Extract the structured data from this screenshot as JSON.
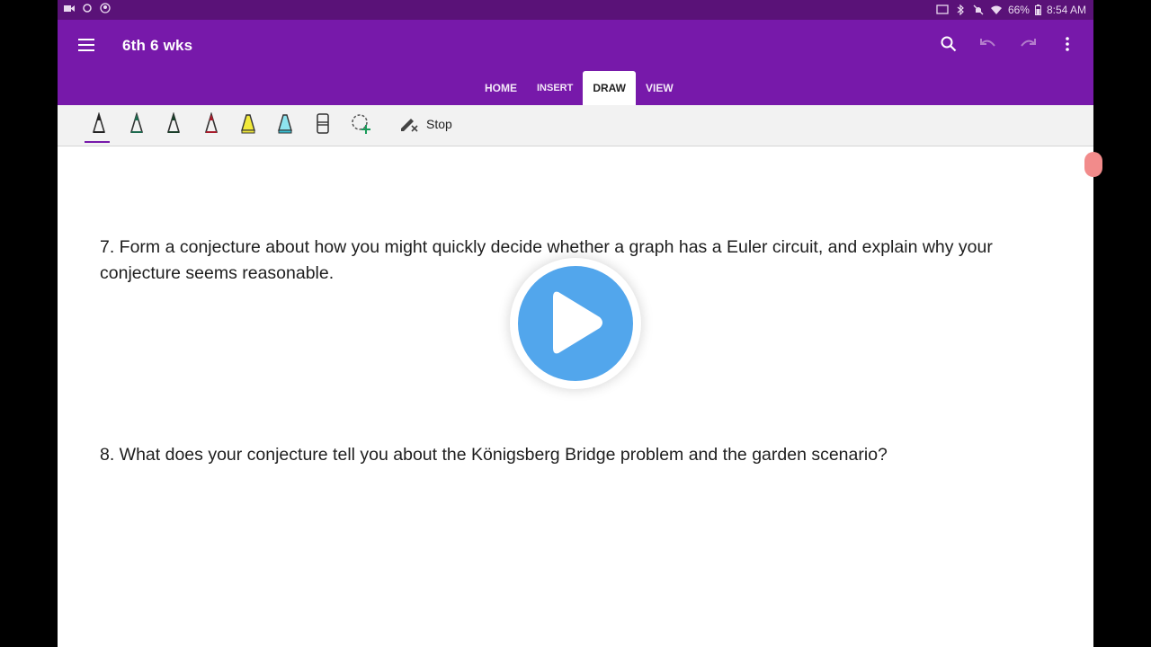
{
  "status_bar": {
    "battery": "66%",
    "time": "8:54 AM"
  },
  "app_bar": {
    "title": "6th 6 wks",
    "icons": [
      "menu-icon",
      "search-icon",
      "undo-icon",
      "redo-icon",
      "more-vert-icon"
    ]
  },
  "tabs": [
    {
      "label": "HOME"
    },
    {
      "label": "INSERT"
    },
    {
      "label": "DRAW",
      "active": true
    },
    {
      "label": "VIEW"
    }
  ],
  "ribbon": {
    "pen_colors": [
      "#222222",
      "#1d6b4f",
      "#1a3f2a",
      "#a81c2c",
      "#f2ea3b",
      "#38c2d6"
    ],
    "stop_label": "Stop"
  },
  "page": {
    "q7": "7. Form a conjecture about how you might quickly decide whether a graph has a Euler circuit, and explain why your conjecture seems reasonable.",
    "q8": "8. What does your conjecture tell you about the Königsberg Bridge problem and the garden scenario?"
  },
  "colors": {
    "accent": "#7719aa",
    "status_bar": "#5a1278",
    "play": "#52a6ec"
  }
}
